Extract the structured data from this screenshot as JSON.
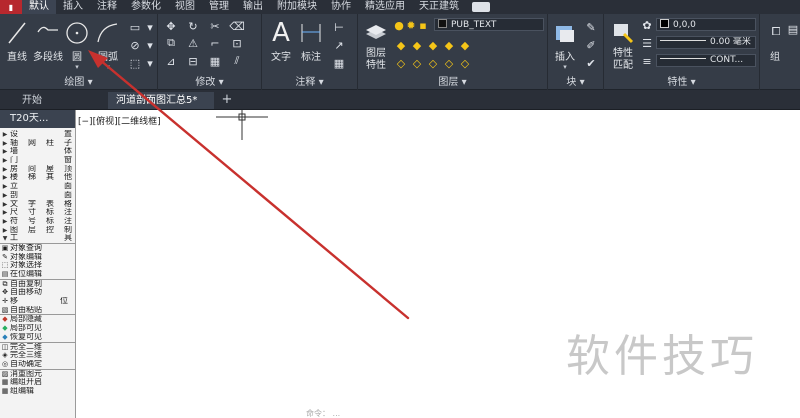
{
  "menu": {
    "tabs": [
      "默认",
      "插入",
      "注释",
      "参数化",
      "视图",
      "管理",
      "输出",
      "附加模块",
      "协作",
      "精选应用",
      "天正建筑"
    ]
  },
  "ribbon": {
    "draw": {
      "title": "绘图 ▾",
      "line": "直线",
      "polyline": "多段线",
      "circle": "圆",
      "arc": "圆弧"
    },
    "modify": {
      "title": "修改 ▾"
    },
    "annotation": {
      "title": "注释 ▾",
      "text": "文字",
      "dimension": "标注"
    },
    "layers": {
      "title": "图层 ▾",
      "properties": "图层\n特性",
      "current_layer": "PUB_TEXT"
    },
    "block": {
      "title": "块 ▾",
      "insert": "插入"
    },
    "properties": {
      "title": "特性 ▾",
      "match": "特性\n匹配",
      "color_value": "0,0,0",
      "lineweight": "0.00 毫米",
      "linetype": "CONT..."
    },
    "group": {
      "title": "组"
    }
  },
  "doc_tabs": {
    "start": "开始",
    "drawing": "河道剖面图汇总5*",
    "close": "✕",
    "add": "+"
  },
  "side_panel": {
    "title": "T20天...",
    "menu_items": [
      "设置",
      "轴网柱子",
      "墙体",
      "门窗",
      "房间屋顶",
      "楼梯其他",
      "立面",
      "剖面",
      "文字表格",
      "尺寸标注",
      "符号标注",
      "图层控制",
      "工具"
    ],
    "object_tools": [
      "对象查询",
      "对象编辑",
      "对象选择",
      "在位编辑"
    ],
    "edit_tools": [
      "自由复制",
      "自由移动",
      "移位",
      "自由粘贴"
    ],
    "visibility_tools": [
      "局部隐藏",
      "局部可见",
      "恢复可见"
    ],
    "view_tools": [
      "完全二维",
      "完全三维",
      "自动确定"
    ],
    "misc_tools": [
      "消重图元",
      "编组开启",
      "组编辑"
    ]
  },
  "canvas": {
    "viewport_label": "[−][俯视][二维线框]",
    "command_line": "命令：  ...",
    "watermark": "软件技巧"
  },
  "colors": {
    "ribbon_bg": "#353c47",
    "menu_bg": "#2a2f38",
    "logo_red": "#b7282e",
    "annotation_arrow": "#c8312e",
    "layer_yellow": "#f5c518"
  }
}
